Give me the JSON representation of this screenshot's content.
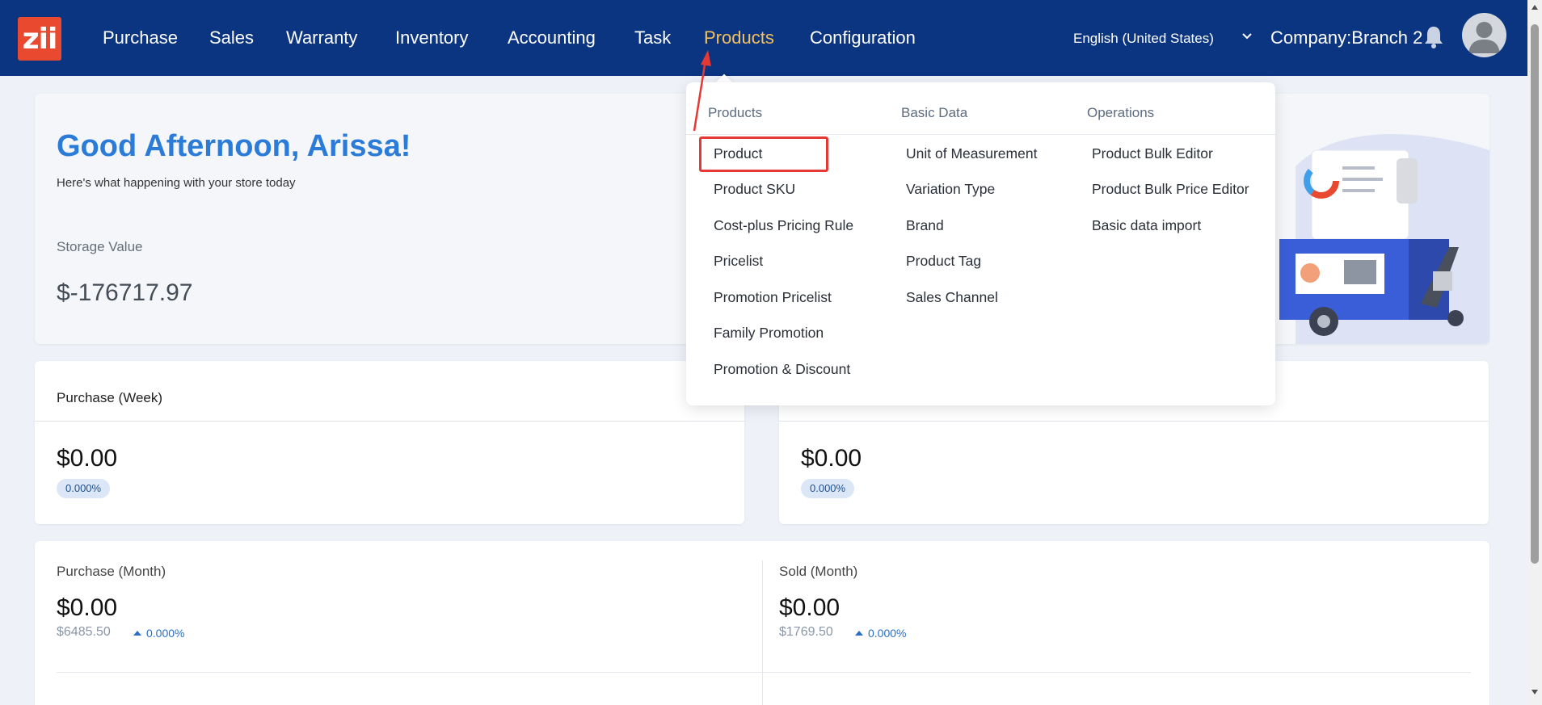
{
  "app": {
    "logo_text": "zii"
  },
  "nav": {
    "items": [
      {
        "label": "Purchase"
      },
      {
        "label": "Sales"
      },
      {
        "label": "Warranty"
      },
      {
        "label": "Inventory"
      },
      {
        "label": "Accounting"
      },
      {
        "label": "Task"
      },
      {
        "label": "Products",
        "active": true
      },
      {
        "label": "Configuration"
      }
    ],
    "language": "English (United States)",
    "company": "Company:Branch 2",
    "colors": {
      "bar": "#0b3580",
      "active": "#f5c15a"
    }
  },
  "welcome": {
    "greeting": "Good Afternoon, Arissa!",
    "subtitle": "Here's what happening with your store today",
    "storage_label": "Storage Value",
    "storage_value": "$-176717.97"
  },
  "week": {
    "purchase": {
      "title": "Purchase (Week)",
      "amount": "$0.00",
      "change": "0.000%"
    },
    "sold": {
      "amount": "$0.00",
      "change": "0.000%"
    }
  },
  "month": {
    "purchase": {
      "title": "Purchase (Month)",
      "amount": "$0.00",
      "previous": "$6485.50",
      "change": "0.000%"
    },
    "sold": {
      "title": "Sold (Month)",
      "amount": "$0.00",
      "previous": "$1769.50",
      "change": "0.000%"
    }
  },
  "dropdown": {
    "columns": [
      {
        "header": "Products",
        "items": [
          "Product",
          "Product SKU",
          "Cost-plus Pricing Rule",
          "Pricelist",
          "Promotion Pricelist",
          "Family Promotion",
          "Promotion & Discount"
        ]
      },
      {
        "header": "Basic Data",
        "items": [
          "Unit of Measurement",
          "Variation Type",
          "Brand",
          "Product Tag",
          "Sales Channel"
        ]
      },
      {
        "header": "Operations",
        "items": [
          "Product Bulk Editor",
          "Product Bulk Price Editor",
          "Basic data import"
        ]
      }
    ],
    "highlighted_item": "Product",
    "annotation_color": "#e53935"
  }
}
